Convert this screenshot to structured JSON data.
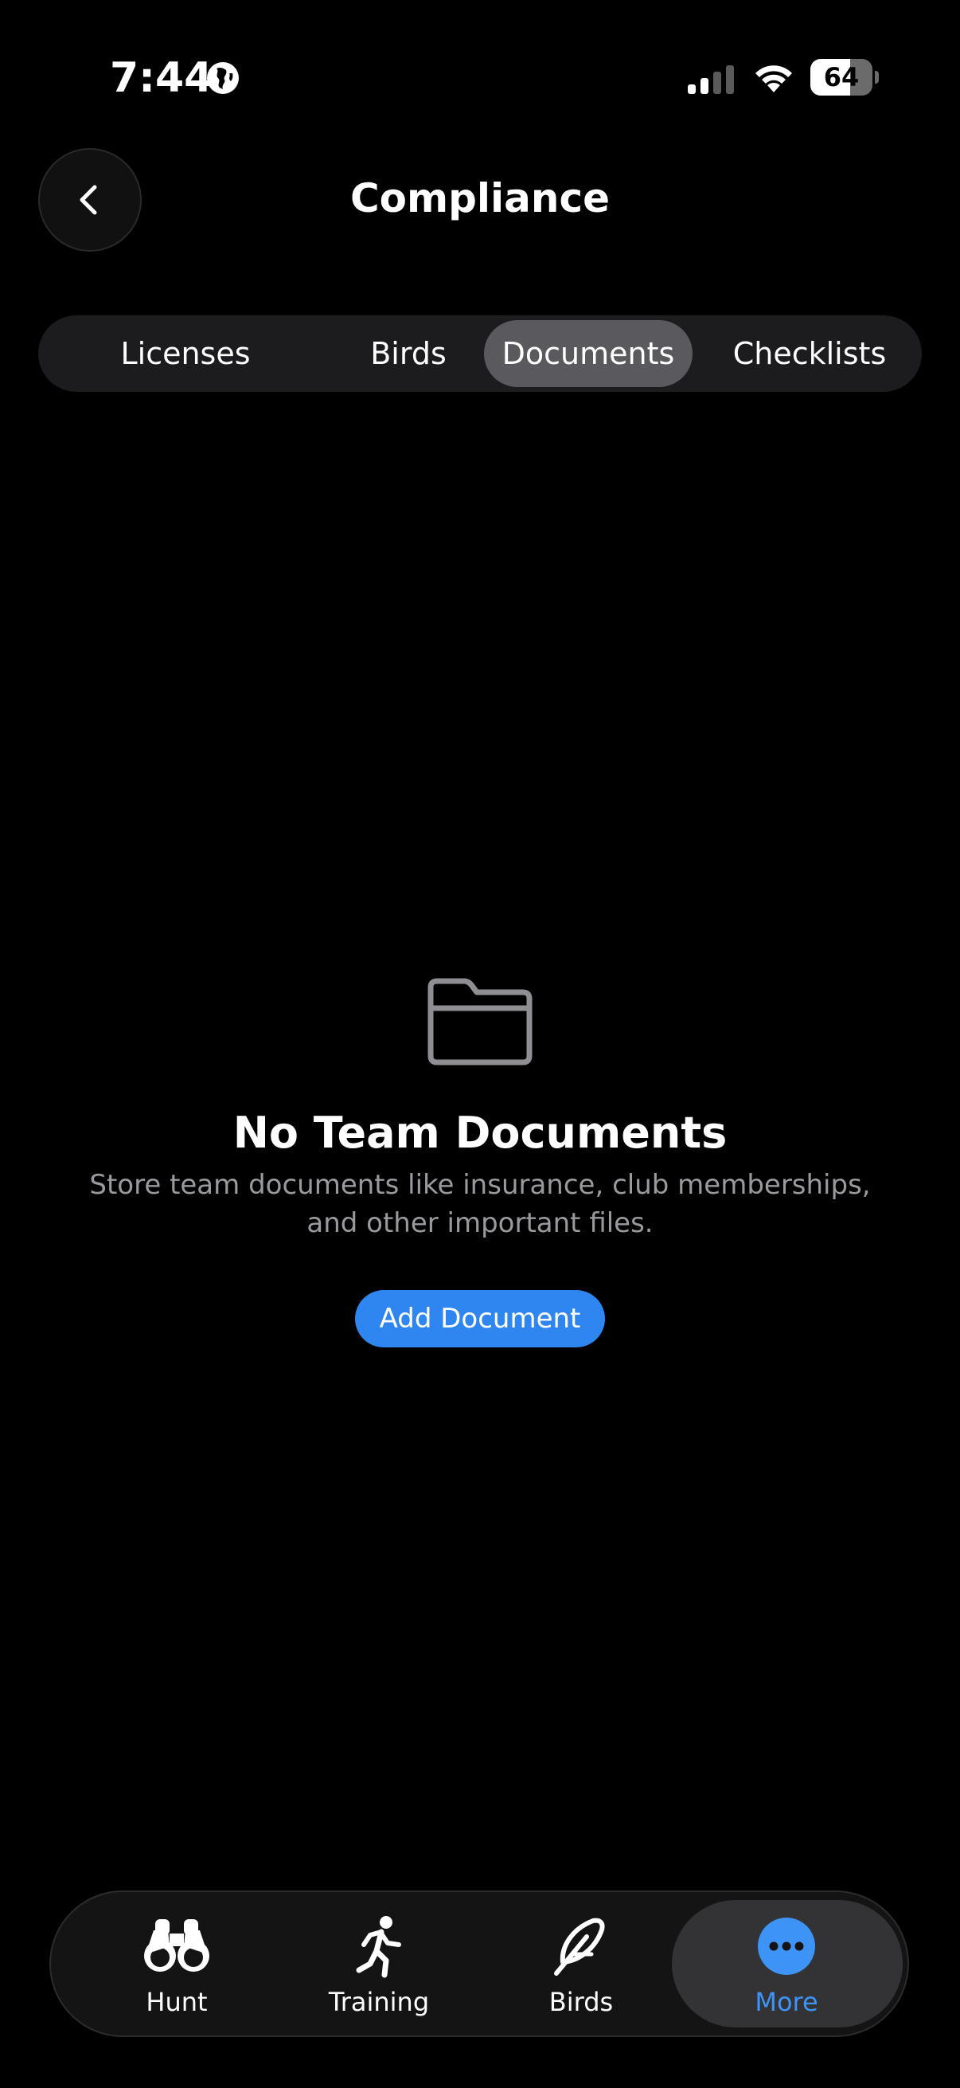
{
  "status_bar": {
    "time": "7:44",
    "battery_level": "64",
    "battery_fraction": 0.64
  },
  "header": {
    "title": "Compliance",
    "back_icon": "chevron-left-icon"
  },
  "tabs": [
    {
      "label": "Licenses",
      "active": false
    },
    {
      "label": "Birds",
      "active": false
    },
    {
      "label": "Documents",
      "active": true
    },
    {
      "label": "Checklists",
      "active": false
    }
  ],
  "empty_state": {
    "icon": "folder-icon",
    "title": "No Team Documents",
    "description": "Store team documents like insurance, club memberships, and other important files.",
    "button_label": "Add Document"
  },
  "tab_bar": {
    "items": [
      {
        "label": "Hunt",
        "icon": "binoculars-icon",
        "active": false
      },
      {
        "label": "Training",
        "icon": "running-figure-icon",
        "active": false
      },
      {
        "label": "Birds",
        "icon": "feather-icon",
        "active": false
      },
      {
        "label": "More",
        "icon": "more-ellipsis-icon",
        "active": true
      }
    ]
  },
  "colors": {
    "background": "#000000",
    "accent": "#2f86f0",
    "active_tab_label": "#3d94f6",
    "segment_active": "#5a5a5e"
  }
}
